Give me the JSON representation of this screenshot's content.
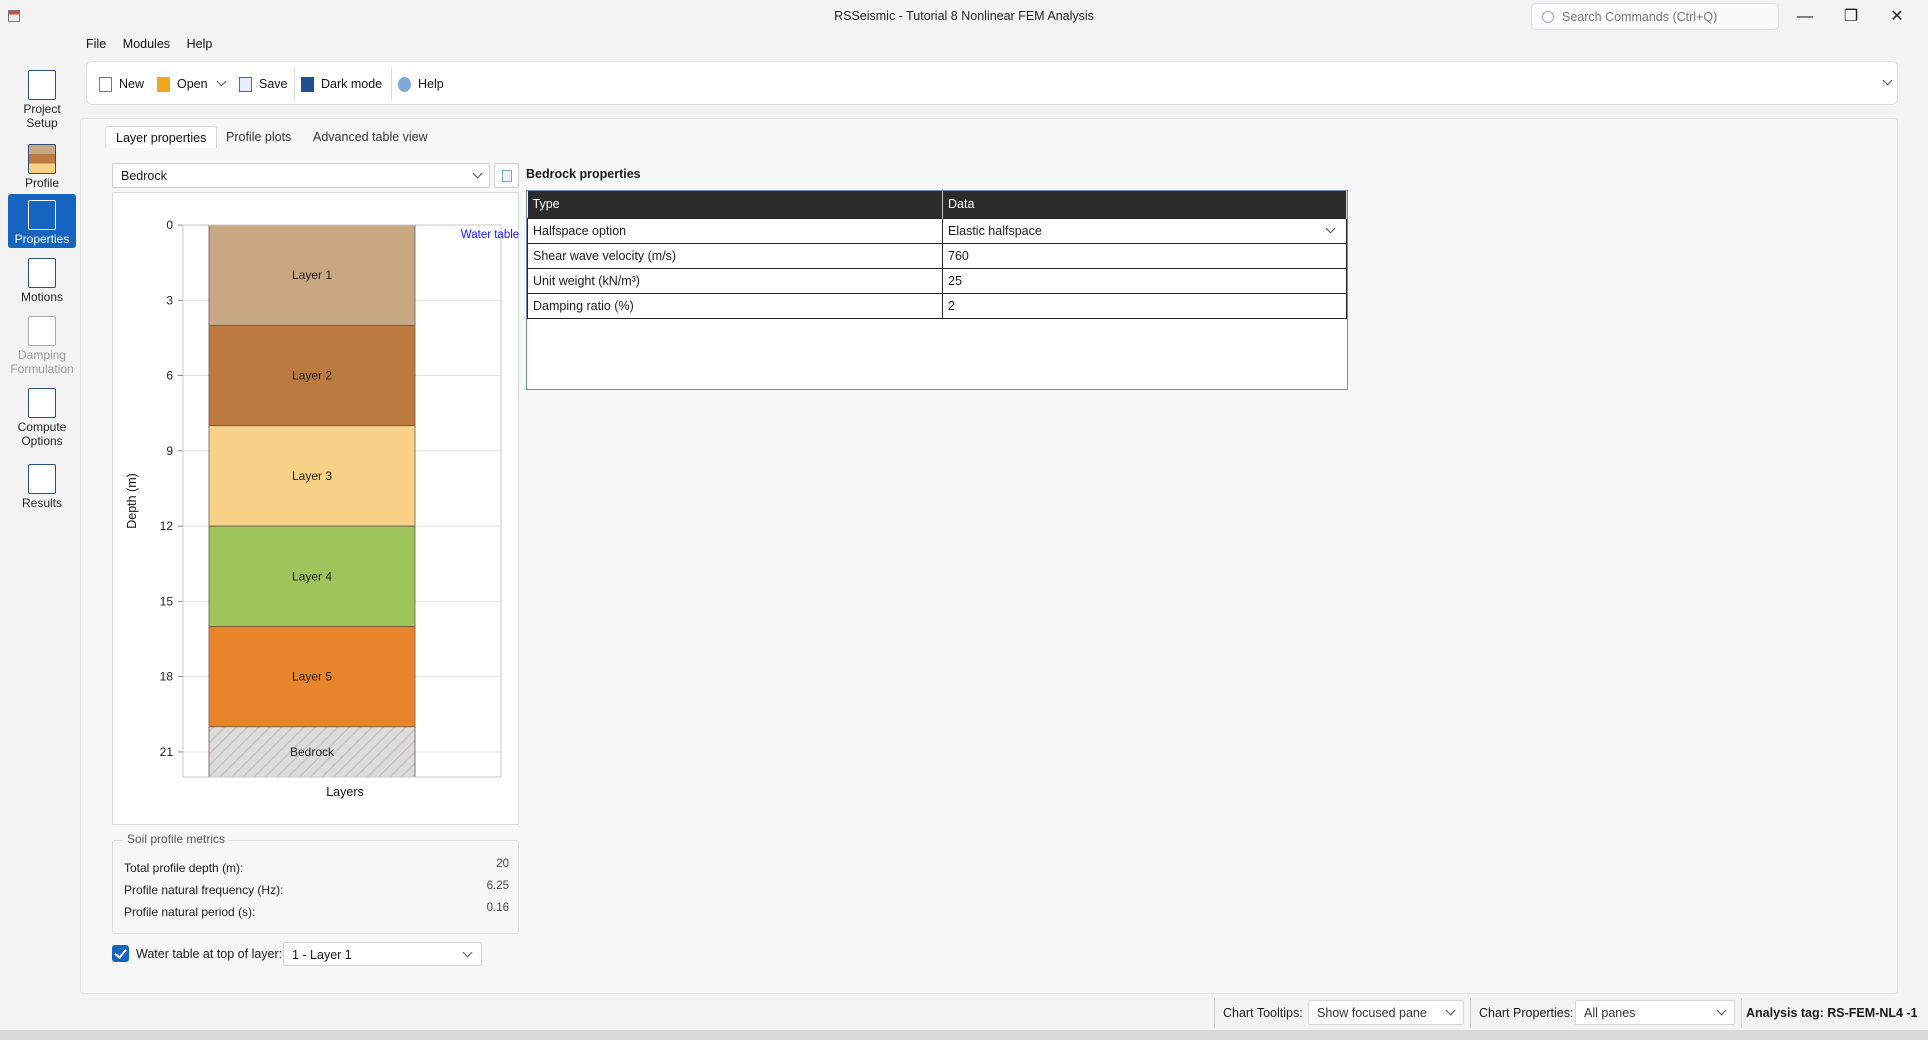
{
  "window": {
    "title": "RSSeismic - Tutorial 8 Nonlinear FEM Analysis",
    "search_placeholder": "Search Commands (Ctrl+Q)",
    "minimize": "—",
    "restore": "❐",
    "close": "✕"
  },
  "menu": [
    "File",
    "Modules",
    "Help"
  ],
  "toolbar": {
    "new": "New",
    "open": "Open",
    "save": "Save",
    "dark_mode": "Dark mode",
    "help": "Help"
  },
  "nav": [
    {
      "label": "Project Setup",
      "icon": "project-setup-icon",
      "state": "normal"
    },
    {
      "label": "Profile",
      "icon": "profile-icon",
      "state": "normal"
    },
    {
      "label": "Properties",
      "icon": "properties-icon",
      "state": "active"
    },
    {
      "label": "Motions",
      "icon": "motions-icon",
      "state": "normal"
    },
    {
      "label": "Damping Formulation",
      "icon": "damping-icon",
      "state": "disabled"
    },
    {
      "label": "Compute Options",
      "icon": "compute-options-icon",
      "state": "normal"
    },
    {
      "label": "Results",
      "icon": "results-icon",
      "state": "normal"
    }
  ],
  "tabs": [
    "Layer properties",
    "Profile plots",
    "Advanced table view"
  ],
  "layer_select": "Bedrock",
  "profile_chart": {
    "y_label": "Depth (m)",
    "x_label": "Layers",
    "y_ticks": [
      "0",
      "3",
      "6",
      "9",
      "12",
      "15",
      "18",
      "21"
    ],
    "water_table_label": "Water table",
    "layers": [
      {
        "name": "Layer 1",
        "top": 0,
        "bottom": 4,
        "color": "#c8a882"
      },
      {
        "name": "Layer 2",
        "top": 4,
        "bottom": 8,
        "color": "#bc7a3e"
      },
      {
        "name": "Layer 3",
        "top": 8,
        "bottom": 12,
        "color": "#f7d286"
      },
      {
        "name": "Layer 4",
        "top": 12,
        "bottom": 16,
        "color": "#9ec45c"
      },
      {
        "name": "Layer 5",
        "top": 16,
        "bottom": 20,
        "color": "#e8842a"
      },
      {
        "name": "Bedrock",
        "top": 20,
        "bottom": 22,
        "color": "#d8d8d8"
      }
    ],
    "y_min": 0,
    "y_max": 22
  },
  "metrics": {
    "title": "Soil profile metrics",
    "rows": [
      {
        "label": "Total profile depth (m):",
        "value": "20"
      },
      {
        "label": "Profile natural frequency (Hz):",
        "value": "6.25"
      },
      {
        "label": "Profile natural period (s):",
        "value": "0.16"
      }
    ]
  },
  "water_table": {
    "label": "Water table at top of layer:",
    "value": "1 - Layer 1",
    "checked": true
  },
  "bedrock": {
    "title": "Bedrock properties",
    "col_type": "Type",
    "col_data": "Data",
    "rows": [
      {
        "type": "Halfspace option",
        "data": "Elastic halfspace"
      },
      {
        "type": "Shear wave velocity (m/s)",
        "data": "760"
      },
      {
        "type": "Unit weight (kN/m³)",
        "data": "25"
      },
      {
        "type": "Damping ratio (%)",
        "data": "2"
      }
    ]
  },
  "status": {
    "chart_tooltips_label": "Chart Tooltips:",
    "chart_tooltips_value": "Show focused pane",
    "chart_properties_label": "Chart Properties:",
    "chart_properties_value": "All panes",
    "analysis_tag": "Analysis tag: RS-FEM-NL4 -1"
  }
}
